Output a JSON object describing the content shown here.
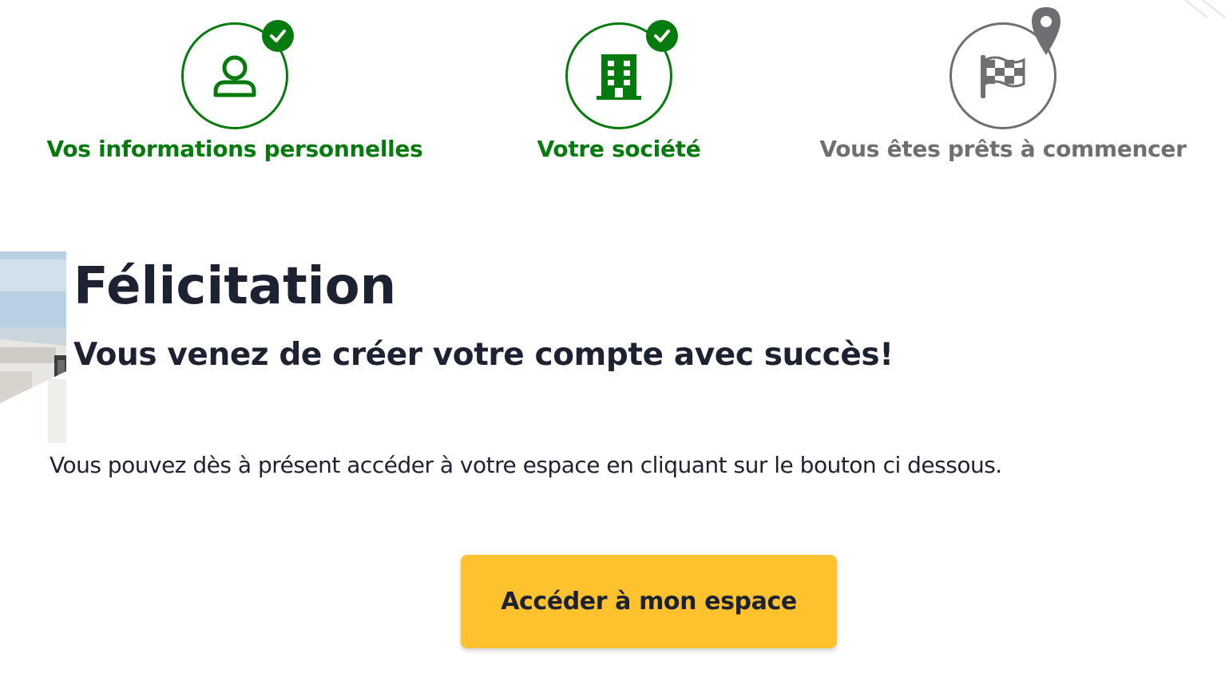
{
  "colors": {
    "success_green": "#057a0d",
    "pending_gray": "#6e6e73",
    "text_dark": "#1d2233",
    "button_yellow": "#fdc22d"
  },
  "stepper": {
    "steps": [
      {
        "label": "Vos informations personnelles",
        "icon": "user-icon",
        "status": "completed"
      },
      {
        "label": "Votre société",
        "icon": "building-icon",
        "status": "completed"
      },
      {
        "label": "Vous êtes prêts à commencer",
        "icon": "checkered-flag-icon",
        "status": "current"
      }
    ]
  },
  "main": {
    "title": "Félicitation",
    "subtitle": "Vous venez de créer votre compte avec succès!",
    "body": "Vous pouvez dès à présent accéder à votre espace en cliquant sur le bouton ci dessous.",
    "cta_label": "Accéder à mon espace"
  }
}
